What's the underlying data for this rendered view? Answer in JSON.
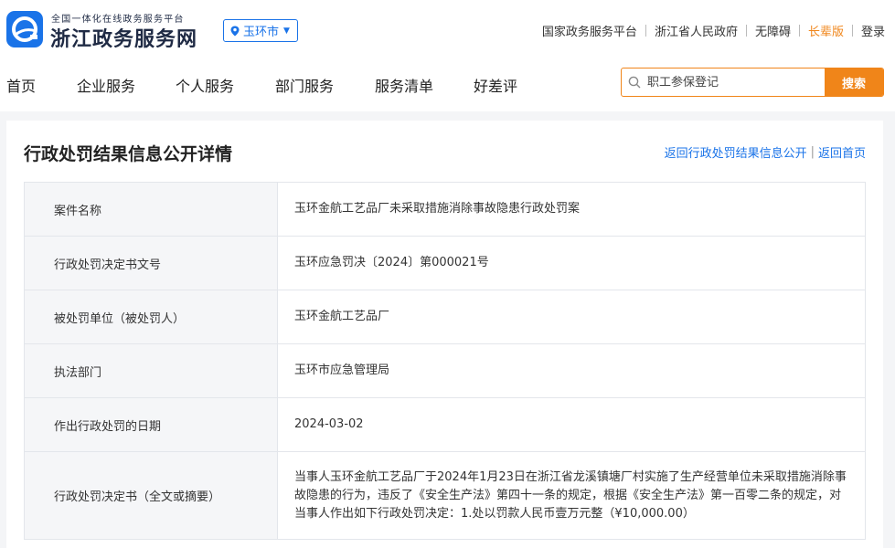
{
  "header": {
    "logo_subtitle": "全国一体化在线政务服务平台",
    "logo_title": "浙江政务服务网",
    "city": "玉环市",
    "links": [
      "国家政务服务平台",
      "浙江省人民政府",
      "无障碍",
      "长辈版",
      "登录"
    ]
  },
  "nav": {
    "items": [
      "首页",
      "企业服务",
      "个人服务",
      "部门服务",
      "服务清单",
      "好差评"
    ],
    "search_placeholder": "职工参保登记",
    "search_button": "搜索"
  },
  "page": {
    "title": "行政处罚结果信息公开详情",
    "back_list": "返回行政处罚结果信息公开",
    "back_home": "返回首页"
  },
  "details": [
    {
      "label": "案件名称",
      "value": "玉环金航工艺品厂未采取措施消除事故隐患行政处罚案"
    },
    {
      "label": "行政处罚决定书文号",
      "value": "玉环应急罚决〔2024〕第000021号"
    },
    {
      "label": "被处罚单位（被处罚人）",
      "value": "玉环金航工艺品厂"
    },
    {
      "label": "执法部门",
      "value": "玉环市应急管理局"
    },
    {
      "label": "作出行政处罚的日期",
      "value": "2024-03-02"
    },
    {
      "label": "行政处罚决定书（全文或摘要）",
      "value": "当事人玉环金航工艺品厂于2024年1月23日在浙江省龙溪镇塘厂村实施了生产经营单位未采取措施消除事故隐患的行为，违反了《安全生产法》第四十一条的规定，根据《安全生产法》第一百零二条的规定，对当事人作出如下行政处罚决定：1.处以罚款人民币壹万元整（¥10,000.00）"
    }
  ],
  "colors": {
    "brand_blue": "#1a73e8",
    "accent_orange": "#f08519"
  }
}
